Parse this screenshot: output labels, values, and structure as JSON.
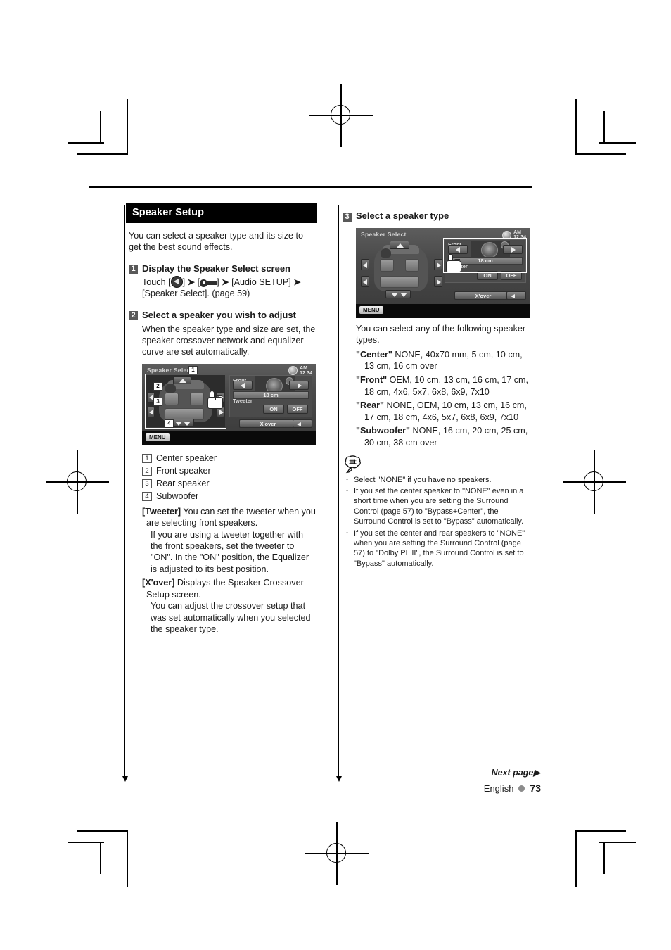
{
  "page": {
    "language": "English",
    "number": "73",
    "next_page": "Next page",
    "next_page_arrow": "▶"
  },
  "left_column": {
    "section_title": "Speaker Setup",
    "intro": "You can select a speaker type and its size to get the best sound effects.",
    "step1": {
      "num": "1",
      "title": "Display the Speaker Select screen",
      "touch_word": "Touch",
      "bracket_open": "[",
      "bracket_close": "]",
      "gt": "➤",
      "audio_setup": "[Audio SETUP]",
      "speaker_select": "[Speaker Select]. (page 59)"
    },
    "step2": {
      "num": "2",
      "title": "Select a speaker you wish to adjust",
      "body": "When the speaker type and size are set, the speaker crossover network and equalizer curve are set automatically."
    },
    "legend": [
      {
        "num": "1",
        "label": "Center speaker"
      },
      {
        "num": "2",
        "label": "Front speaker"
      },
      {
        "num": "3",
        "label": "Rear speaker"
      },
      {
        "num": "4",
        "label": "Subwoofer"
      }
    ],
    "definitions": [
      {
        "term": "[Tweeter]",
        "text": "You can set the tweeter when you are selecting front speakers.",
        "cont": "If you are using a tweeter together with the front speakers, set the tweeter to \"ON\". In the \"ON\" position, the Equalizer is adjusted to its best position."
      },
      {
        "term": "[X'over]",
        "text": "Displays the Speaker Crossover Setup screen.",
        "cont": "You can adjust the crossover setup that was set automatically when you selected the speaker type."
      }
    ],
    "device": {
      "title": "Speaker Select",
      "time_ampm": "AM",
      "time": "12:34",
      "front_label": "Front",
      "tweeter_label": "Tweeter",
      "size_value": "18 cm",
      "on_label": "ON",
      "off_label": "OFF",
      "xover_label": "X'over",
      "menu_label": "MENU",
      "markers": [
        "1",
        "2",
        "3",
        "4"
      ]
    }
  },
  "right_column": {
    "step3": {
      "num": "3",
      "title": "Select a speaker type",
      "body": "You can select any of the following speaker types."
    },
    "device": {
      "title": "Speaker Select",
      "time_ampm": "AM",
      "time": "12:34",
      "front_label": "Front",
      "tweeter_label": "Tweeter",
      "size_value": "18 cm",
      "on_label": "ON",
      "off_label": "OFF",
      "xover_label": "X'over",
      "menu_label": "MENU"
    },
    "specs": [
      {
        "term": "\"Center\"",
        "values": "NONE, 40x70 mm, 5 cm, 10 cm, 13 cm, 16 cm over"
      },
      {
        "term": "\"Front\"",
        "values": "OEM, 10 cm, 13 cm, 16 cm, 17 cm, 18 cm, 4x6, 5x7, 6x8, 6x9, 7x10"
      },
      {
        "term": "\"Rear\"",
        "values": "NONE, OEM, 10 cm, 13 cm, 16 cm, 17 cm, 18 cm, 4x6, 5x7, 6x8, 6x9, 7x10"
      },
      {
        "term": "\"Subwoofer\"",
        "values": "NONE, 16 cm, 20 cm, 25 cm, 30 cm, 38 cm over"
      }
    ],
    "notes": [
      "Select \"NONE\" if you have no speakers.",
      "If you set the center speaker to \"NONE\" even in a short time when you are setting the Surround Control (page 57) to \"Bypass+Center\", the Surround Control is set to \"Bypass\" automatically.",
      "If you set the center and rear speakers to \"NONE\" when you are setting the Surround Control (page 57) to \"Dolby PL II\", the Surround Control is set to \"Bypass\" automatically."
    ]
  }
}
